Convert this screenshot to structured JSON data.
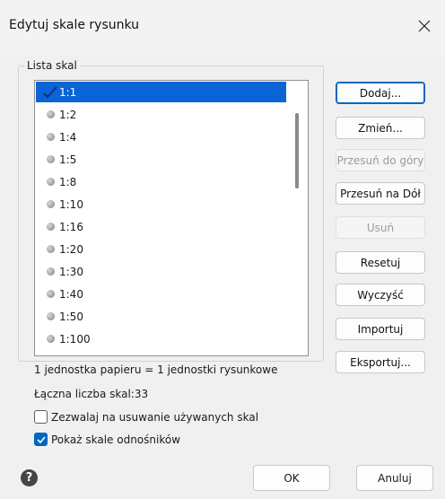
{
  "window": {
    "title": "Edytuj skale rysunku"
  },
  "scale_list": {
    "group_label": "Lista skal",
    "items": [
      {
        "label": "1:1",
        "selected": true,
        "icon": "checkmark-icon"
      },
      {
        "label": "1:2",
        "selected": false,
        "icon": "dot-icon"
      },
      {
        "label": "1:4",
        "selected": false,
        "icon": "dot-icon"
      },
      {
        "label": "1:5",
        "selected": false,
        "icon": "dot-icon"
      },
      {
        "label": "1:8",
        "selected": false,
        "icon": "dot-icon"
      },
      {
        "label": "1:10",
        "selected": false,
        "icon": "dot-icon"
      },
      {
        "label": "1:16",
        "selected": false,
        "icon": "dot-icon"
      },
      {
        "label": "1:20",
        "selected": false,
        "icon": "dot-icon"
      },
      {
        "label": "1:30",
        "selected": false,
        "icon": "dot-icon"
      },
      {
        "label": "1:40",
        "selected": false,
        "icon": "dot-icon"
      },
      {
        "label": "1:50",
        "selected": false,
        "icon": "dot-icon"
      },
      {
        "label": "1:100",
        "selected": false,
        "icon": "dot-icon"
      }
    ]
  },
  "buttons": {
    "add": "Dodaj...",
    "change": "Zmień...",
    "move_up": "Przesuń do góry",
    "move_down": "Przesuń na Dół",
    "delete": "Usuń",
    "reset": "Resetuj",
    "clear": "Wyczyść",
    "import": "Importuj",
    "export": "Eksportuj..."
  },
  "info": {
    "unit_ratio": "1 jednostka papieru = 1 jednostki rysunkowe",
    "total_count": "Łączna liczba skal:33"
  },
  "options": {
    "allow_delete_used": {
      "label": "Zezwalaj na usuwanie używanych skal",
      "checked": false
    },
    "show_reference_scales": {
      "label": "Pokaż skale odnośników",
      "checked": true
    }
  },
  "footer": {
    "ok": "OK",
    "cancel": "Anuluj"
  },
  "colors": {
    "selection": "#0a64d6",
    "accent": "#0067c0"
  }
}
